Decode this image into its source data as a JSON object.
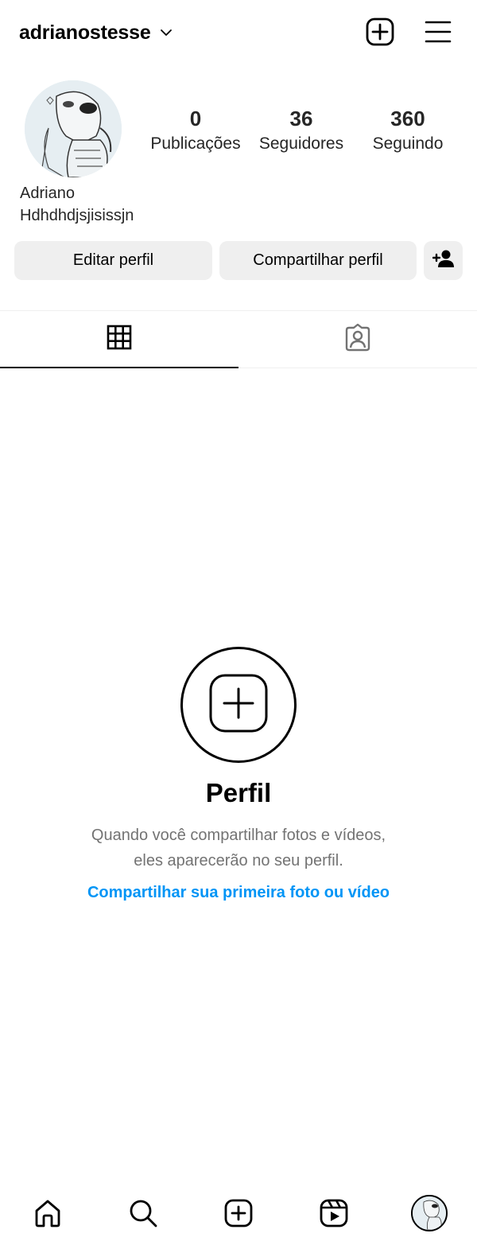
{
  "header": {
    "username": "adrianostesse",
    "icons": {
      "switch_account": "chevron-down-icon",
      "create": "create-plus-square-icon",
      "menu": "hamburger-menu-icon"
    }
  },
  "profile": {
    "stats": [
      {
        "count": "0",
        "label": "Publicações"
      },
      {
        "count": "36",
        "label": "Seguidores"
      },
      {
        "count": "360",
        "label": "Seguindo"
      }
    ],
    "display_name": "Adriano",
    "bio": "Hdhdhdjsjisissjn"
  },
  "actions": {
    "edit_label": "Editar perfil",
    "share_label": "Compartilhar perfil",
    "discover_icon": "add-person-icon"
  },
  "tabs": [
    {
      "name": "posts-grid",
      "icon": "grid-icon",
      "active": true
    },
    {
      "name": "tagged",
      "icon": "tagged-person-icon",
      "active": false
    }
  ],
  "empty_state": {
    "title": "Perfil",
    "description": "Quando você compartilhar fotos e vídeos, eles aparecerão no seu perfil.",
    "cta": "Compartilhar sua primeira foto ou vídeo"
  },
  "bottom_nav": {
    "items": [
      "home-icon",
      "search-icon",
      "create-icon",
      "reels-icon",
      "profile-avatar"
    ]
  },
  "colors": {
    "link": "#0095f6",
    "button_bg": "#efefef",
    "secondary_text": "#737373"
  }
}
